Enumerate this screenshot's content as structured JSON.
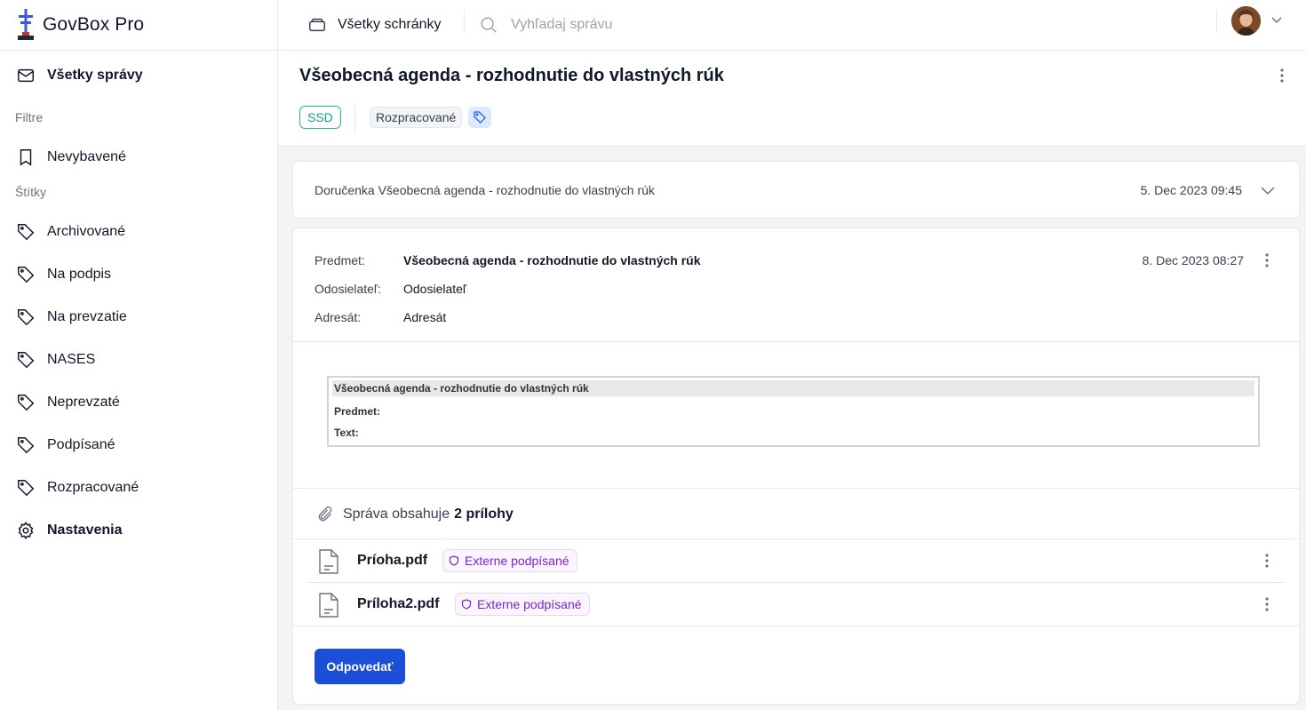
{
  "app": {
    "name": "GovBox Pro"
  },
  "topbar": {
    "mailbox_label": "Všetky schránky",
    "search_placeholder": "Vyhľadaj správu"
  },
  "sidebar": {
    "all_messages": "Všetky správy",
    "filters_heading": "Filtre",
    "filters": [
      {
        "label": "Nevybavené",
        "icon": "bookmark-icon"
      }
    ],
    "tags_heading": "Štítky",
    "tags": [
      {
        "label": "Archivované",
        "icon": "tag-icon"
      },
      {
        "label": "Na podpis",
        "icon": "tag-icon"
      },
      {
        "label": "Na prevzatie",
        "icon": "tag-icon"
      },
      {
        "label": "NASES",
        "icon": "tag-icon"
      },
      {
        "label": "Neprevzaté",
        "icon": "tag-icon"
      },
      {
        "label": "Podpísané",
        "icon": "tag-icon"
      },
      {
        "label": "Rozpracované",
        "icon": "tag-icon"
      }
    ],
    "settings": "Nastavenia"
  },
  "thread": {
    "title": "Všeobecná agenda - rozhodnutie do vlastných rúk",
    "box_badge": "SSD",
    "tag": "Rozpracované"
  },
  "receipt": {
    "subject": "Doručenka Všeobecná agenda - rozhodnutie do vlastných rúk",
    "date": "5. Dec 2023 09:45"
  },
  "message": {
    "subject_label": "Predmet:",
    "subject": "Všeobecná agenda - rozhodnutie do vlastných rúk",
    "sender_label": "Odosielateľ:",
    "sender": "Odosielateľ",
    "recipient_label": "Adresát:",
    "recipient": "Adresát",
    "date": "8. Dec 2023 08:27",
    "form": {
      "header": "Všeobecná agenda - rozhodnutie do vlastných rúk",
      "subject_label": "Predmet:",
      "text_label": "Text:"
    },
    "attachments_prefix": "Správa obsahuje",
    "attachments_count": "2 prílohy",
    "attachments": [
      {
        "name": "Príoha.pdf",
        "badge": "Externe podpísané"
      },
      {
        "name": "Príloha2.pdf",
        "badge": "Externe podpísané"
      }
    ],
    "reply_label": "Odpovedať"
  },
  "colors": {
    "accent": "#1d4ed8",
    "ssd_badge": "#2bb39c",
    "signed_badge": "#7e22ce"
  }
}
